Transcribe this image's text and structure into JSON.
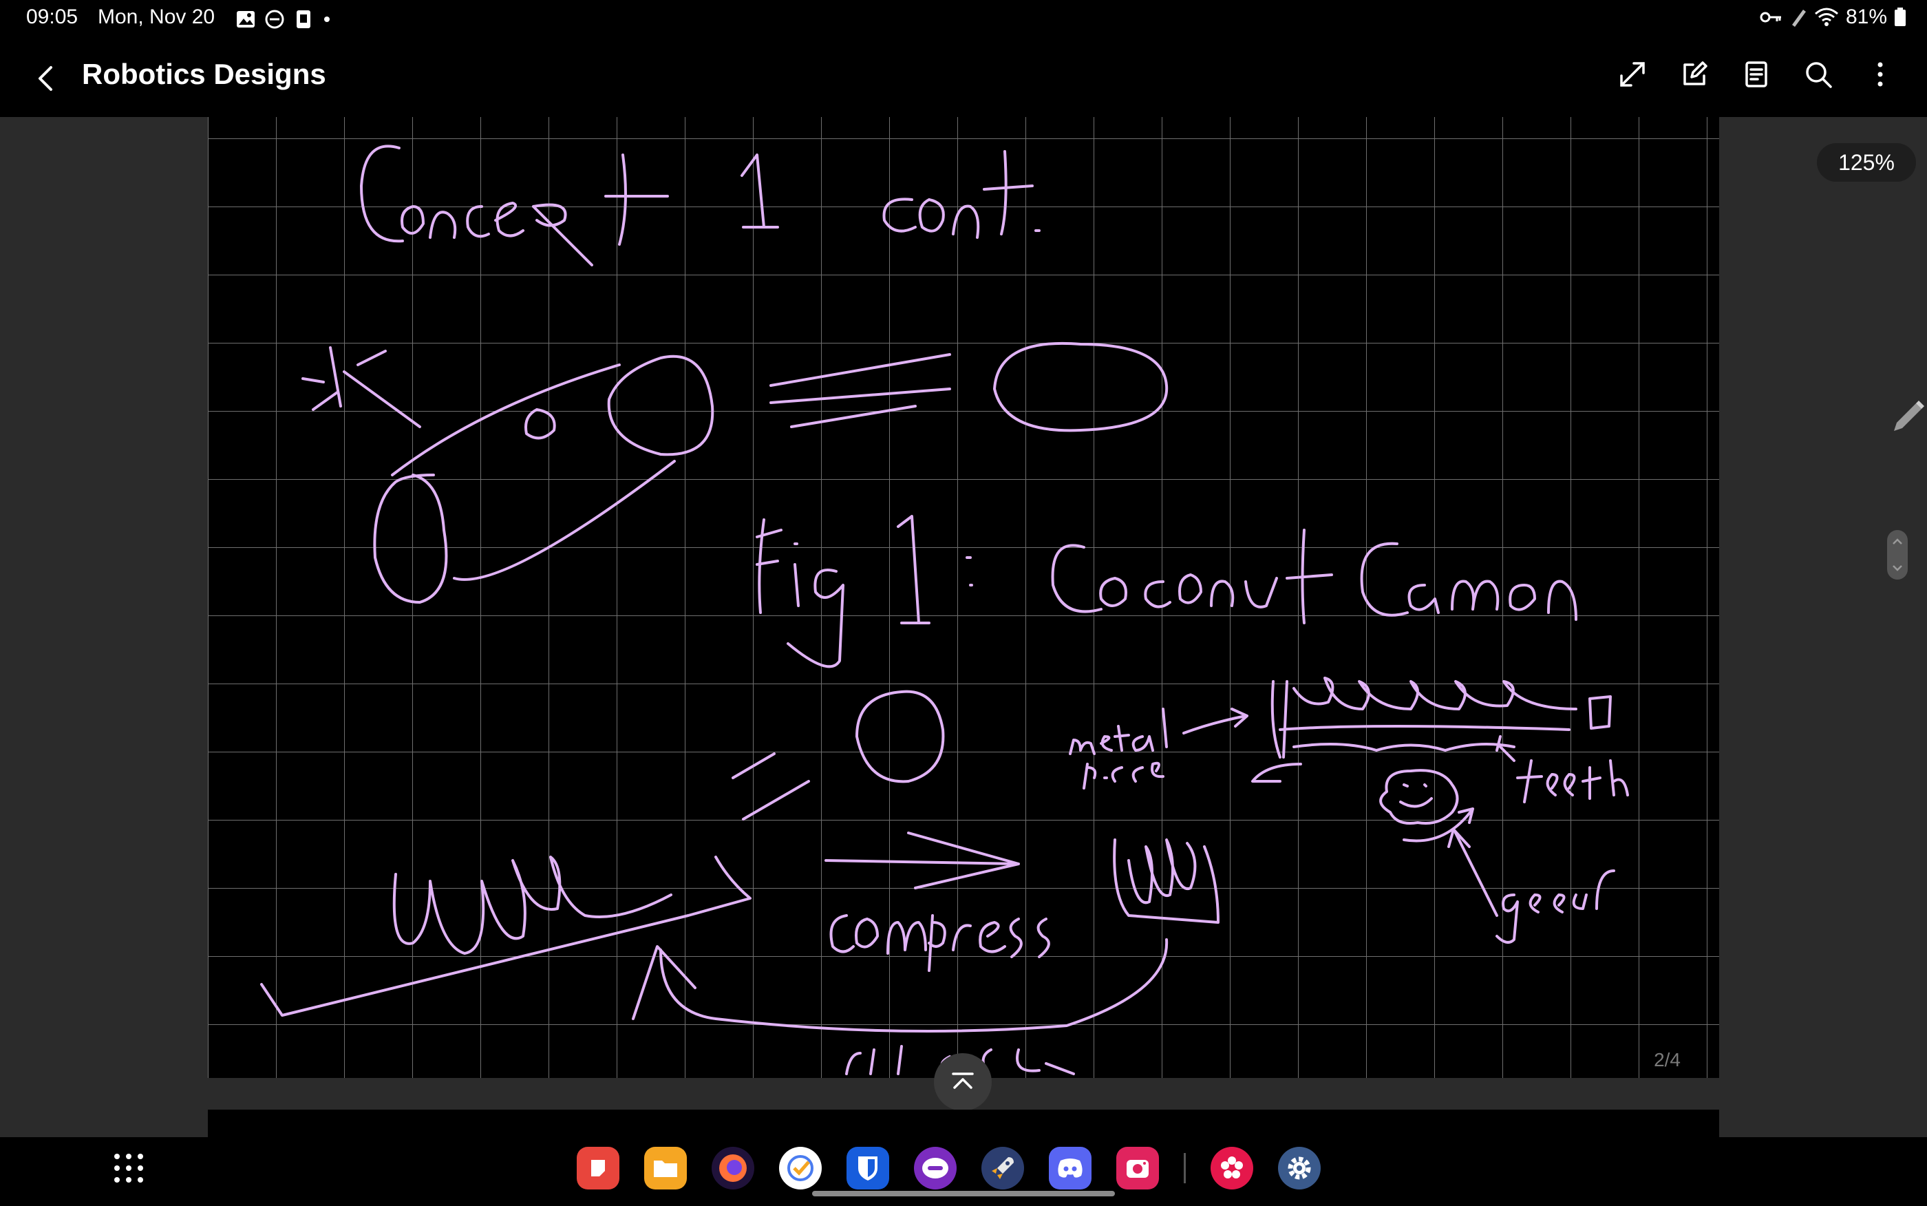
{
  "status_bar": {
    "time": "09:05",
    "date": "Mon, Nov 20",
    "battery": "81%"
  },
  "app_bar": {
    "title": "Robotics Designs"
  },
  "canvas": {
    "zoom": "125%",
    "page_indicator": "2/4",
    "ink_color": "#e0b3f5",
    "grid_color": "#777777",
    "background": "#000000"
  },
  "dock": {
    "apps": [
      "notes-app",
      "files-app",
      "firefox-app",
      "tasks-app",
      "bitwarden-app",
      "messages-app",
      "rocket-app",
      "discord-app",
      "camera-app",
      "blossom-app",
      "settings-app"
    ]
  }
}
